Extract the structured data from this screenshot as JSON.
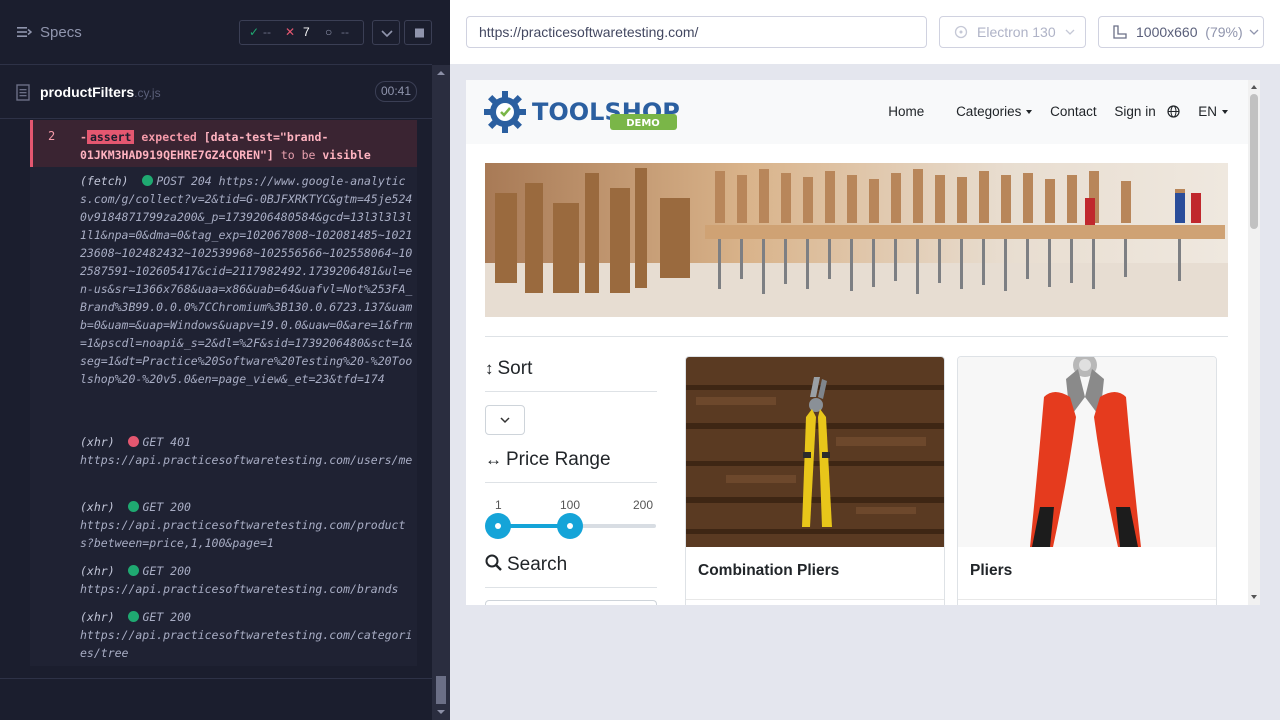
{
  "runner": {
    "specs_label": "Specs",
    "stats": {
      "passed": "--",
      "failed": "7",
      "pending": "--"
    },
    "spec_file": {
      "name": "productFilters",
      "ext": ".cy.js",
      "duration": "00:41"
    }
  },
  "command_log": {
    "assert": {
      "index": "2",
      "prefix": "-",
      "tag": "assert",
      "text_before": "expected",
      "selector": "[data-test=\"brand-01JKM3HAD919QEHRE7GZ4CQREN\"]",
      "text_after": "to be",
      "state": "visible"
    },
    "entries": [
      {
        "kind": "(fetch)",
        "status": "green",
        "method_status": "POST 204",
        "url": "https://www.google-analytics.com/g/collect?v=2&tid=G-0BJFXRKTYC&gtm=45je5240v9184871799za200&_p=1739206480584&gcd=13l3l3l3l1l1&npa=0&dma=0&tag_exp=102067808~102081485~102123608~102482432~102539968~102556566~102558064~102587591~102605417&cid=2117982492.1739206481&ul=en-us&sr=1366x768&uaa=x86&uab=64&uafvl=Not%253FA_Brand%3B99.0.0.0%7CChromium%3B130.0.6723.137&uamb=0&uam=&uap=Windows&uapv=19.0.0&uaw=0&are=1&frm=1&pscdl=noapi&_s=2&dl=%2F&sid=1739206480&sct=1&seg=1&dt=Practice%20Software%20Testing%20-%20Toolshop%20-%20v5.0&en=page_view&_et=23&tfd=174"
      },
      {
        "kind": "(xhr)",
        "status": "red",
        "method_status": "GET 401",
        "url": "https://api.practicesoftwaretesting.com/users/me"
      },
      {
        "kind": "(xhr)",
        "status": "green",
        "method_status": "GET 200",
        "url": "https://api.practicesoftwaretesting.com/products?between=price,1,100&page=1"
      },
      {
        "kind": "(xhr)",
        "status": "green",
        "method_status": "GET 200",
        "url": "https://api.practicesoftwaretesting.com/brands"
      },
      {
        "kind": "(xhr)",
        "status": "green",
        "method_status": "GET 200",
        "url": "https://api.practicesoftwaretesting.com/categories/tree"
      }
    ]
  },
  "aut_bar": {
    "url": "https://practicesoftwaretesting.com/",
    "browser": "Electron 130",
    "viewport": "1000x660",
    "zoom": "(79%)"
  },
  "app": {
    "logo_text": "TOOLSHOP",
    "logo_badge": "DEMO",
    "nav": {
      "home": "Home",
      "categories": "Categories",
      "contact": "Contact",
      "sign_in": "Sign in",
      "language": "EN"
    },
    "filters": {
      "sort_title": "Sort",
      "price_title": "Price Range",
      "price_min_label": "1",
      "price_current_label": "100",
      "price_max_label": "200",
      "price_low": 1,
      "price_high": 100,
      "search_title": "Search"
    },
    "products": [
      {
        "name": "Combination Pliers"
      },
      {
        "name": "Pliers"
      }
    ]
  }
}
